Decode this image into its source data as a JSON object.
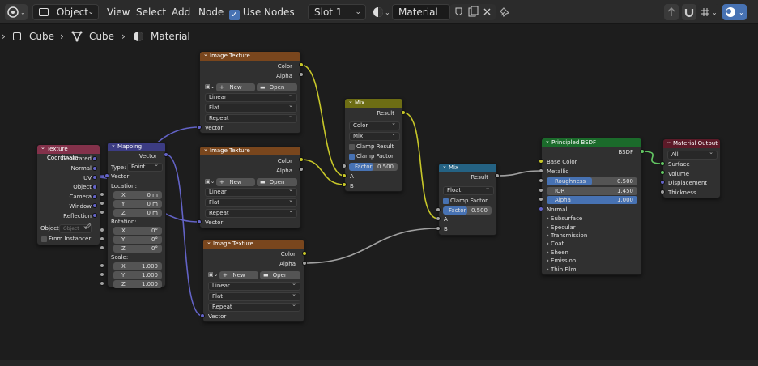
{
  "header": {
    "mode": "Object",
    "menus": [
      "View",
      "Select",
      "Add",
      "Node"
    ],
    "use_nodes": "Use Nodes",
    "slot": "Slot 1",
    "material": "Material"
  },
  "breadcrumb": [
    "Cube",
    "Cube",
    "Material"
  ],
  "texcoord": {
    "title": "Texture Coordinate",
    "outputs": [
      "Generated",
      "Normal",
      "UV",
      "Object",
      "Camera",
      "Window",
      "Reflection"
    ],
    "object_label": "Object:",
    "object_placeholder": "Object",
    "from_instancer": "From Instancer"
  },
  "mapping": {
    "title": "Mapping",
    "out": "Vector",
    "type_label": "Type:",
    "type": "Point",
    "vector": "Vector",
    "location": "Location:",
    "rotation": "Rotation:",
    "scale": "Scale:",
    "axes": [
      "X",
      "Y",
      "Z"
    ],
    "loc": [
      "0 m",
      "0 m",
      "0 m"
    ],
    "rot": [
      "0°",
      "0°",
      "0°"
    ],
    "scl": [
      "1.000",
      "1.000",
      "1.000"
    ]
  },
  "img1": {
    "title": "Image Texture",
    "color": "Color",
    "alpha": "Alpha",
    "new": "New",
    "open": "Open",
    "interp": "Linear",
    "proj": "Flat",
    "ext": "Repeat",
    "vector": "Vector"
  },
  "img2": {
    "title": "Image Texture",
    "color": "Color",
    "alpha": "Alpha",
    "new": "New",
    "open": "Open",
    "interp": "Linear",
    "proj": "Flat",
    "ext": "Repeat",
    "vector": "Vector"
  },
  "img3": {
    "title": "Image Texture",
    "color": "Color",
    "alpha": "Alpha",
    "new": "New",
    "open": "Open",
    "interp": "Linear",
    "proj": "Flat",
    "ext": "Repeat",
    "vector": "Vector"
  },
  "mix1": {
    "title": "Mix",
    "result": "Result",
    "type": "Color",
    "blend": "Mix",
    "clamp_result": "Clamp Result",
    "clamp_factor": "Clamp Factor",
    "factor": "Factor",
    "factor_val": "0.500",
    "factor_fraction": 0.5,
    "a": "A",
    "b": "B"
  },
  "mix2": {
    "title": "Mix",
    "result": "Result",
    "type": "Float",
    "clamp_factor": "Clamp Factor",
    "factor": "Factor",
    "factor_val": "0.500",
    "factor_fraction": 0.5,
    "a": "A",
    "b": "B"
  },
  "bsdf": {
    "title": "Principled BSDF",
    "out": "BSDF",
    "base_color": "Base Color",
    "metallic": "Metallic",
    "roughness": "Roughness",
    "roughness_val": "0.500",
    "roughness_fraction": 0.5,
    "ior": "IOR",
    "ior_val": "1.450",
    "alpha": "Alpha",
    "alpha_val": "1.000",
    "alpha_fraction": 1.0,
    "normal": "Normal",
    "panels": [
      "Subsurface",
      "Specular",
      "Transmission",
      "Coat",
      "Sheen",
      "Emission",
      "Thin Film"
    ]
  },
  "output": {
    "title": "Material Output",
    "target": "All",
    "inputs": [
      "Surface",
      "Volume",
      "Displacement",
      "Thickness"
    ]
  },
  "colors": {
    "input_header": "#83314a",
    "vector_header": "#3c3c83",
    "texture_header": "#79461d",
    "converter_header": "#246283",
    "shader_header": "#1b6b2b",
    "output_header": "#5c1a28",
    "mix_header": "#6d6d14",
    "yellow": "#c7c729",
    "grey": "#a1a1a1",
    "purple": "#6363c7",
    "green": "#63c763"
  }
}
